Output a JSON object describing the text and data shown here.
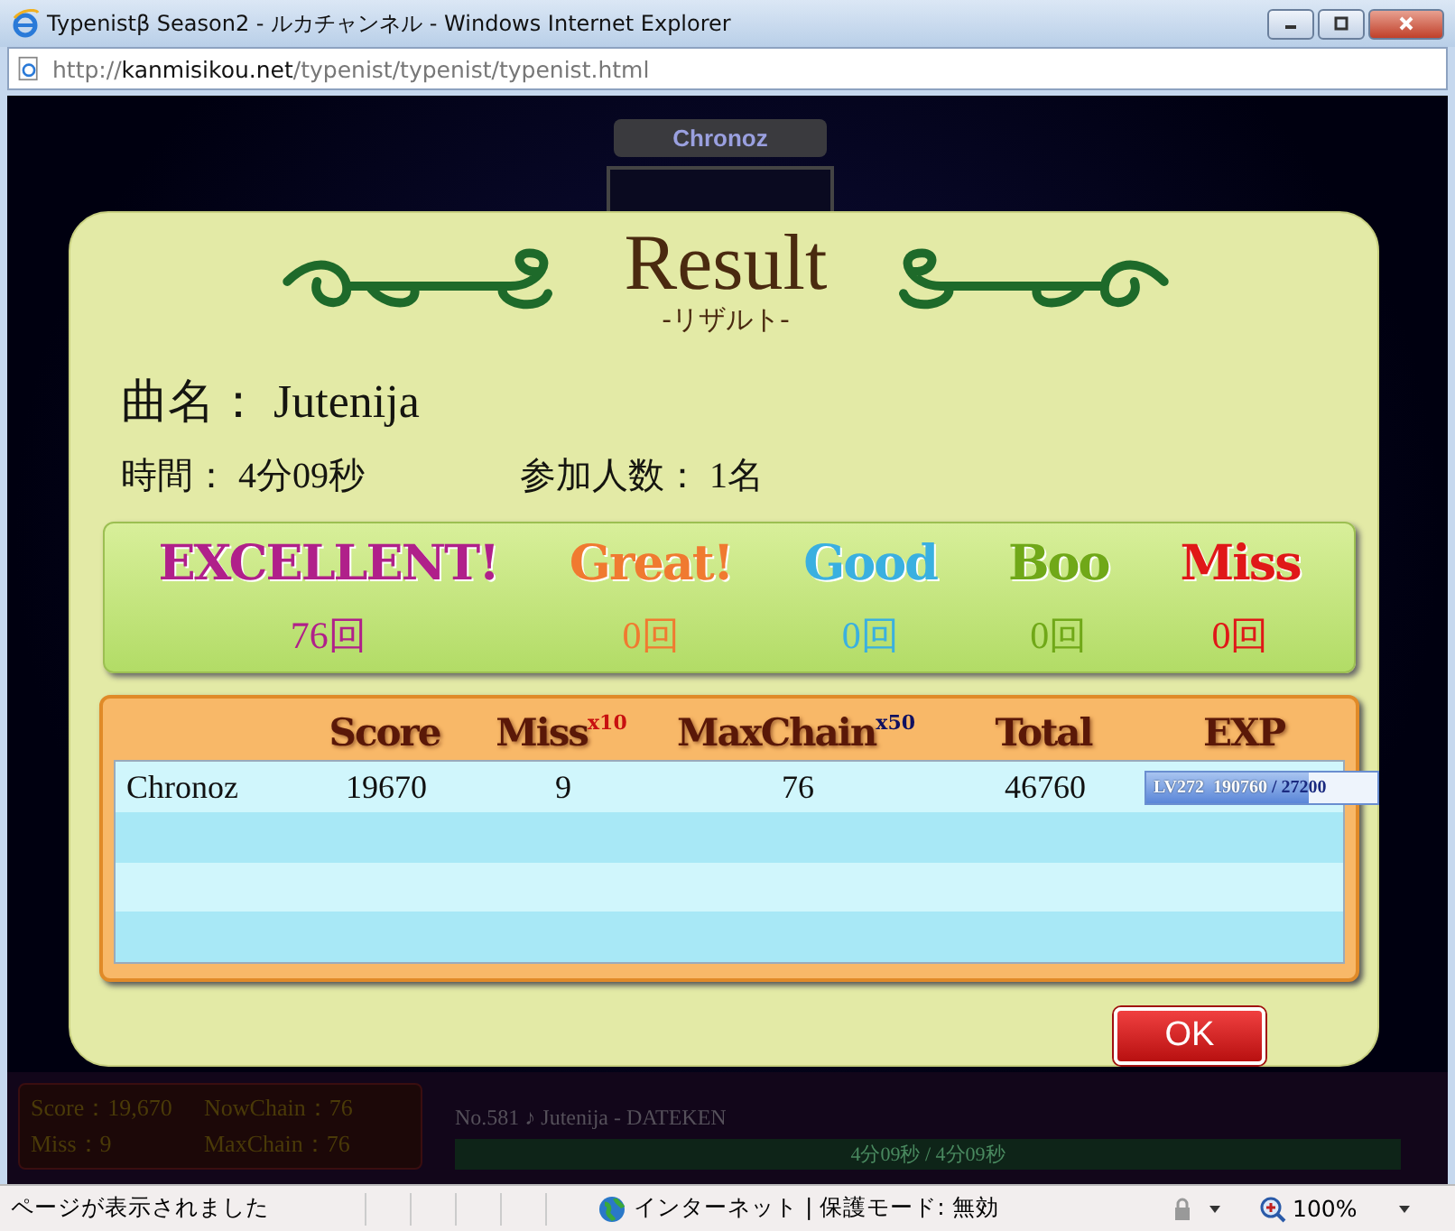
{
  "window": {
    "title": "Typenistβ Season2 - ルカチャンネル - Windows Internet Explorer"
  },
  "address_bar": {
    "url_prefix": "http://",
    "url_host": "kanmisikou.net",
    "url_path": "/typenist/typenist/typenist.html"
  },
  "game": {
    "player_plate": "Chronoz",
    "stats": [
      {
        "label": "Score：",
        "value": "19,670"
      },
      {
        "label": "NowChain：",
        "value": "76"
      },
      {
        "label": "Miss：",
        "value": "9"
      },
      {
        "label": "MaxChain：",
        "value": "76"
      }
    ],
    "song_info": "No.581 ♪ Jutenija - DATEKEN",
    "progress": {
      "text": "4分09秒 / 4分09秒",
      "level": 1
    }
  },
  "result": {
    "title": "Result",
    "subtitle": "-リザルト-",
    "song_label": "曲名：",
    "song": "Jutenija",
    "time_label": "時間：",
    "time": "4分09秒",
    "players_label": "参加人数：",
    "players": "1名",
    "judgments": [
      {
        "label": "EXCELLENT!",
        "count": "76回",
        "color": "#b0208a"
      },
      {
        "label": "Great!",
        "count": "0回",
        "color": "#f07a30"
      },
      {
        "label": "Good",
        "count": "0回",
        "color": "#3ab0e0"
      },
      {
        "label": "Boo",
        "count": "0回",
        "color": "#70a818"
      },
      {
        "label": "Miss",
        "count": "0回",
        "color": "#e01818"
      }
    ],
    "columns": [
      {
        "label": "Score"
      },
      {
        "label": "Miss",
        "multiplier": "x10"
      },
      {
        "label": "MaxChain",
        "multiplier": "x50"
      },
      {
        "label": "Total"
      },
      {
        "label": "EXP"
      }
    ],
    "rows": [
      {
        "name": "Chronoz",
        "score": "19670",
        "miss": "9",
        "max_chain": "76",
        "total": "46760",
        "exp": {
          "level_label": "LV272",
          "current": "190760",
          "separator": "/",
          "next": "27200",
          "level": 0.7
        }
      }
    ],
    "ok_button": "OK"
  },
  "status_bar": {
    "message": "ページが表示されました",
    "zone": "インターネット | 保護モード: 無効",
    "zoom": "100%"
  }
}
